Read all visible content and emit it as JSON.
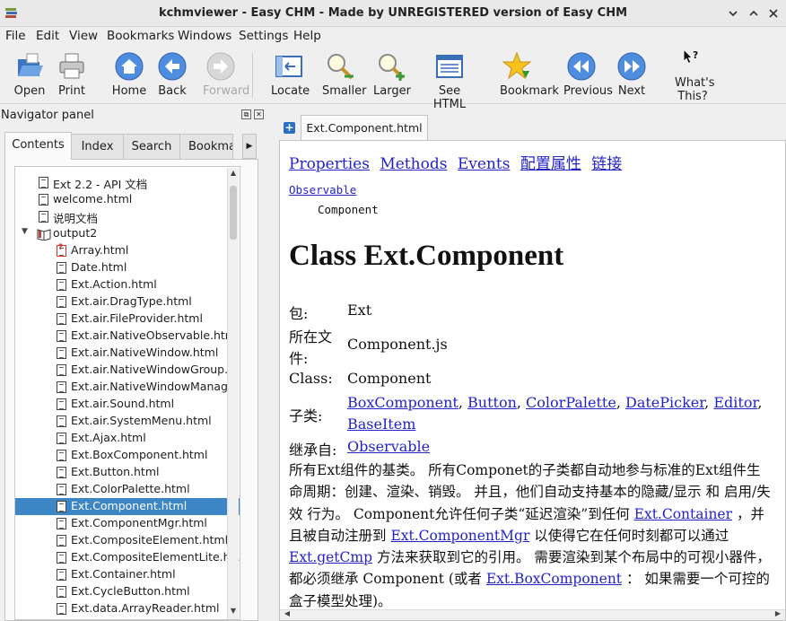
{
  "window": {
    "title": "kchmviewer - Easy CHM - Made by UNREGISTERED version of Easy CHM"
  },
  "menu": [
    "File",
    "Edit",
    "View",
    "Bookmarks",
    "Windows",
    "Settings",
    "Help"
  ],
  "toolbar": {
    "open": "Open",
    "print": "Print",
    "home": "Home",
    "back": "Back",
    "forward": "Forward",
    "locate": "Locate",
    "smaller": "Smaller",
    "larger": "Larger",
    "see_html": "See HTML",
    "bookmark": "Bookmark",
    "previous": "Previous",
    "next": "Next",
    "whats_this": "What's This?"
  },
  "navigator": {
    "title": "Navigator panel",
    "tabs": [
      "Contents",
      "Index",
      "Search",
      "Bookma"
    ],
    "tree": [
      {
        "label": "Ext 2.2 - API 文档",
        "level": 1,
        "icon": "page"
      },
      {
        "label": "welcome.html",
        "level": 1,
        "icon": "page"
      },
      {
        "label": "说明文档",
        "level": 1,
        "icon": "page"
      },
      {
        "label": "output2",
        "level": 1,
        "icon": "book",
        "expanded": true
      },
      {
        "label": "Array.html",
        "level": 2,
        "icon": "page-missing"
      },
      {
        "label": "Date.html",
        "level": 2,
        "icon": "page"
      },
      {
        "label": "Ext.Action.html",
        "level": 2,
        "icon": "page"
      },
      {
        "label": "Ext.air.DragType.html",
        "level": 2,
        "icon": "page"
      },
      {
        "label": "Ext.air.FileProvider.html",
        "level": 2,
        "icon": "page"
      },
      {
        "label": "Ext.air.NativeObservable.html",
        "level": 2,
        "icon": "page"
      },
      {
        "label": "Ext.air.NativeWindow.html",
        "level": 2,
        "icon": "page"
      },
      {
        "label": "Ext.air.NativeWindowGroup....",
        "level": 2,
        "icon": "page"
      },
      {
        "label": "Ext.air.NativeWindowManag...",
        "level": 2,
        "icon": "page"
      },
      {
        "label": "Ext.air.Sound.html",
        "level": 2,
        "icon": "page"
      },
      {
        "label": "Ext.air.SystemMenu.html",
        "level": 2,
        "icon": "page"
      },
      {
        "label": "Ext.Ajax.html",
        "level": 2,
        "icon": "page"
      },
      {
        "label": "Ext.BoxComponent.html",
        "level": 2,
        "icon": "page"
      },
      {
        "label": "Ext.Button.html",
        "level": 2,
        "icon": "page"
      },
      {
        "label": "Ext.ColorPalette.html",
        "level": 2,
        "icon": "page"
      },
      {
        "label": "Ext.Component.html",
        "level": 2,
        "icon": "page",
        "selected": true
      },
      {
        "label": "Ext.ComponentMgr.html",
        "level": 2,
        "icon": "page"
      },
      {
        "label": "Ext.CompositeElement.html",
        "level": 2,
        "icon": "page"
      },
      {
        "label": "Ext.CompositeElementLite.ht...",
        "level": 2,
        "icon": "page"
      },
      {
        "label": "Ext.Container.html",
        "level": 2,
        "icon": "page"
      },
      {
        "label": "Ext.CycleButton.html",
        "level": 2,
        "icon": "page"
      },
      {
        "label": "Ext.data.ArrayReader.html",
        "level": 2,
        "icon": "page"
      }
    ]
  },
  "content": {
    "tab": "Ext.Component.html",
    "top_links": [
      "Properties",
      "Methods",
      "Events",
      "配置属性",
      "链接"
    ],
    "hierarchy_parent": "Observable",
    "hierarchy_child": "Component",
    "heading": "Class Ext.Component",
    "package_label": "包:",
    "package_value": "Ext",
    "file_label_1": "所在文",
    "file_label_2": "件:",
    "file_value": "Component.js",
    "class_label": "Class:",
    "class_value": "Component",
    "subclass_label": "子类:",
    "subclasses": [
      "BoxComponent",
      "Button",
      "ColorPalette",
      "DatePicker",
      "Editor",
      "BaseItem"
    ],
    "extends_label": "继承自:",
    "extends_value": "Observable",
    "desc": {
      "p1": "所有Ext组件的基类。 所有Componet的子类都自动地参与标准的Ext组件生命周期：创建、渲染、销毁。 并且，他们自动支持基本的隐藏/显示 和 启用/失效 行为。 Component允许任何子类“延迟渲染”到任何 ",
      "link1": "Ext.Container",
      "p2": " ，并且被自动注册到 ",
      "link2": "Ext.ComponentMgr",
      "p3": " 以使得它在任何时刻都可以通过 ",
      "link3": "Ext.getCmp",
      "p4": " 方法来获取到它的引用。 需要渲染到某个布局中的可视小器件，都必须继承 Component (或者 ",
      "link4": "Ext.BoxComponent",
      "p5": " ： 如果需要一个可控的盒子模型处理)。"
    }
  }
}
